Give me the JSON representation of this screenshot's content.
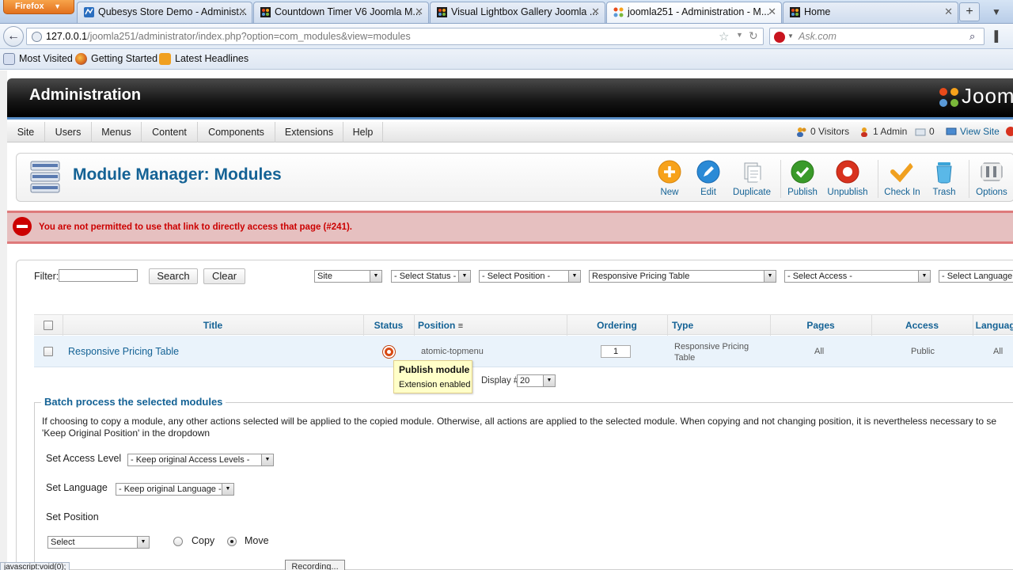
{
  "browser": {
    "app_button": "Firefox",
    "tabs": [
      {
        "label": "Qubesys Store Demo - Administ...",
        "color": "#2a6ebf"
      },
      {
        "label": "Countdown Timer V6 Joomla M...",
        "color": "#c0392b"
      },
      {
        "label": "Visual Lightbox Gallery Joomla ...",
        "color": "#c0392b"
      },
      {
        "label": "joomla251 - Administration - M...",
        "color": "#2a6ebf"
      },
      {
        "label": "Home",
        "color": "#c0392b"
      }
    ],
    "url_host": "127.0.0.1",
    "url_path": "/joomla251/administrator/index.php?option=com_modules&view=modules",
    "search_placeholder": "Ask.com",
    "bookmarks": [
      "Most Visited",
      "Getting Started",
      "Latest Headlines"
    ],
    "status_link": "javascript:void(0);"
  },
  "header": {
    "title": "Administration",
    "logo_text": "Joomla"
  },
  "menu": {
    "items": [
      "Site",
      "Users",
      "Menus",
      "Content",
      "Components",
      "Extensions",
      "Help"
    ],
    "status": {
      "visitors": "0 Visitors",
      "admins": "1 Admin",
      "messages": "0",
      "view_site": "View Site"
    }
  },
  "toolbar": {
    "title": "Module Manager: Modules",
    "buttons": [
      {
        "label": "New",
        "color": "#f7a21b"
      },
      {
        "label": "Edit",
        "color": "#2a8ad6"
      },
      {
        "label": "Duplicate",
        "color": "#9aa4ad"
      },
      {
        "label": "Publish",
        "color": "#3a9a2a"
      },
      {
        "label": "Unpublish",
        "color": "#d8321e"
      },
      {
        "label": "Check In",
        "color": "#f0a020"
      },
      {
        "label": "Trash",
        "color": "#3aa4d8"
      },
      {
        "label": "Options",
        "color": "#7a8088"
      }
    ]
  },
  "error": {
    "message": "You are not permitted to use that link to directly access that page (#241)."
  },
  "filter": {
    "label": "Filter:",
    "value": "",
    "search_button": "Search",
    "clear_button": "Clear",
    "selects": [
      "Site",
      "- Select Status -",
      "- Select Position -",
      "Responsive Pricing Table",
      "- Select Access -",
      "- Select Language -"
    ]
  },
  "table": {
    "columns": [
      "Title",
      "Status",
      "Position",
      "Ordering",
      "Type",
      "Pages",
      "Access",
      "Language"
    ],
    "rows": [
      {
        "title": "Responsive Pricing Table",
        "position": "atomic-topmenu",
        "ordering": "1",
        "type_line1": "Responsive Pricing",
        "type_line2": "Table",
        "pages": "All",
        "access": "Public",
        "language": "All"
      }
    ]
  },
  "tooltip": {
    "title": "Publish module",
    "text": "Extension enabled"
  },
  "pager": {
    "label": "Display #",
    "value": "20"
  },
  "batch": {
    "legend": "Batch process the selected modules",
    "desc_line1": "If choosing to copy a module, any other actions selected will be applied to the copied module. Otherwise, all actions are applied to the selected module. When copying and not changing position, it is nevertheless necessary to se",
    "desc_line2": "'Keep Original Position' in the dropdown",
    "access_label": "Set Access Level",
    "access_value": "- Keep original Access Levels -",
    "language_label": "Set Language",
    "language_value": "- Keep original Language -",
    "position_label": "Set Position",
    "position_value": "Select",
    "copy_label": "Copy",
    "move_label": "Move"
  },
  "recording_label": "Recording..."
}
